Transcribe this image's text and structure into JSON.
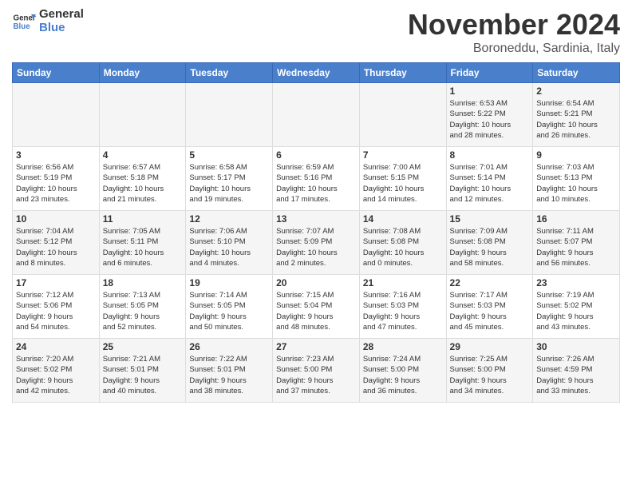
{
  "header": {
    "logo_line1": "General",
    "logo_line2": "Blue",
    "title": "November 2024",
    "location": "Boroneddu, Sardinia, Italy"
  },
  "weekdays": [
    "Sunday",
    "Monday",
    "Tuesday",
    "Wednesday",
    "Thursday",
    "Friday",
    "Saturday"
  ],
  "weeks": [
    [
      {
        "day": "",
        "info": ""
      },
      {
        "day": "",
        "info": ""
      },
      {
        "day": "",
        "info": ""
      },
      {
        "day": "",
        "info": ""
      },
      {
        "day": "",
        "info": ""
      },
      {
        "day": "1",
        "info": "Sunrise: 6:53 AM\nSunset: 5:22 PM\nDaylight: 10 hours\nand 28 minutes."
      },
      {
        "day": "2",
        "info": "Sunrise: 6:54 AM\nSunset: 5:21 PM\nDaylight: 10 hours\nand 26 minutes."
      }
    ],
    [
      {
        "day": "3",
        "info": "Sunrise: 6:56 AM\nSunset: 5:19 PM\nDaylight: 10 hours\nand 23 minutes."
      },
      {
        "day": "4",
        "info": "Sunrise: 6:57 AM\nSunset: 5:18 PM\nDaylight: 10 hours\nand 21 minutes."
      },
      {
        "day": "5",
        "info": "Sunrise: 6:58 AM\nSunset: 5:17 PM\nDaylight: 10 hours\nand 19 minutes."
      },
      {
        "day": "6",
        "info": "Sunrise: 6:59 AM\nSunset: 5:16 PM\nDaylight: 10 hours\nand 17 minutes."
      },
      {
        "day": "7",
        "info": "Sunrise: 7:00 AM\nSunset: 5:15 PM\nDaylight: 10 hours\nand 14 minutes."
      },
      {
        "day": "8",
        "info": "Sunrise: 7:01 AM\nSunset: 5:14 PM\nDaylight: 10 hours\nand 12 minutes."
      },
      {
        "day": "9",
        "info": "Sunrise: 7:03 AM\nSunset: 5:13 PM\nDaylight: 10 hours\nand 10 minutes."
      }
    ],
    [
      {
        "day": "10",
        "info": "Sunrise: 7:04 AM\nSunset: 5:12 PM\nDaylight: 10 hours\nand 8 minutes."
      },
      {
        "day": "11",
        "info": "Sunrise: 7:05 AM\nSunset: 5:11 PM\nDaylight: 10 hours\nand 6 minutes."
      },
      {
        "day": "12",
        "info": "Sunrise: 7:06 AM\nSunset: 5:10 PM\nDaylight: 10 hours\nand 4 minutes."
      },
      {
        "day": "13",
        "info": "Sunrise: 7:07 AM\nSunset: 5:09 PM\nDaylight: 10 hours\nand 2 minutes."
      },
      {
        "day": "14",
        "info": "Sunrise: 7:08 AM\nSunset: 5:08 PM\nDaylight: 10 hours\nand 0 minutes."
      },
      {
        "day": "15",
        "info": "Sunrise: 7:09 AM\nSunset: 5:08 PM\nDaylight: 9 hours\nand 58 minutes."
      },
      {
        "day": "16",
        "info": "Sunrise: 7:11 AM\nSunset: 5:07 PM\nDaylight: 9 hours\nand 56 minutes."
      }
    ],
    [
      {
        "day": "17",
        "info": "Sunrise: 7:12 AM\nSunset: 5:06 PM\nDaylight: 9 hours\nand 54 minutes."
      },
      {
        "day": "18",
        "info": "Sunrise: 7:13 AM\nSunset: 5:05 PM\nDaylight: 9 hours\nand 52 minutes."
      },
      {
        "day": "19",
        "info": "Sunrise: 7:14 AM\nSunset: 5:05 PM\nDaylight: 9 hours\nand 50 minutes."
      },
      {
        "day": "20",
        "info": "Sunrise: 7:15 AM\nSunset: 5:04 PM\nDaylight: 9 hours\nand 48 minutes."
      },
      {
        "day": "21",
        "info": "Sunrise: 7:16 AM\nSunset: 5:03 PM\nDaylight: 9 hours\nand 47 minutes."
      },
      {
        "day": "22",
        "info": "Sunrise: 7:17 AM\nSunset: 5:03 PM\nDaylight: 9 hours\nand 45 minutes."
      },
      {
        "day": "23",
        "info": "Sunrise: 7:19 AM\nSunset: 5:02 PM\nDaylight: 9 hours\nand 43 minutes."
      }
    ],
    [
      {
        "day": "24",
        "info": "Sunrise: 7:20 AM\nSunset: 5:02 PM\nDaylight: 9 hours\nand 42 minutes."
      },
      {
        "day": "25",
        "info": "Sunrise: 7:21 AM\nSunset: 5:01 PM\nDaylight: 9 hours\nand 40 minutes."
      },
      {
        "day": "26",
        "info": "Sunrise: 7:22 AM\nSunset: 5:01 PM\nDaylight: 9 hours\nand 38 minutes."
      },
      {
        "day": "27",
        "info": "Sunrise: 7:23 AM\nSunset: 5:00 PM\nDaylight: 9 hours\nand 37 minutes."
      },
      {
        "day": "28",
        "info": "Sunrise: 7:24 AM\nSunset: 5:00 PM\nDaylight: 9 hours\nand 36 minutes."
      },
      {
        "day": "29",
        "info": "Sunrise: 7:25 AM\nSunset: 5:00 PM\nDaylight: 9 hours\nand 34 minutes."
      },
      {
        "day": "30",
        "info": "Sunrise: 7:26 AM\nSunset: 4:59 PM\nDaylight: 9 hours\nand 33 minutes."
      }
    ]
  ]
}
